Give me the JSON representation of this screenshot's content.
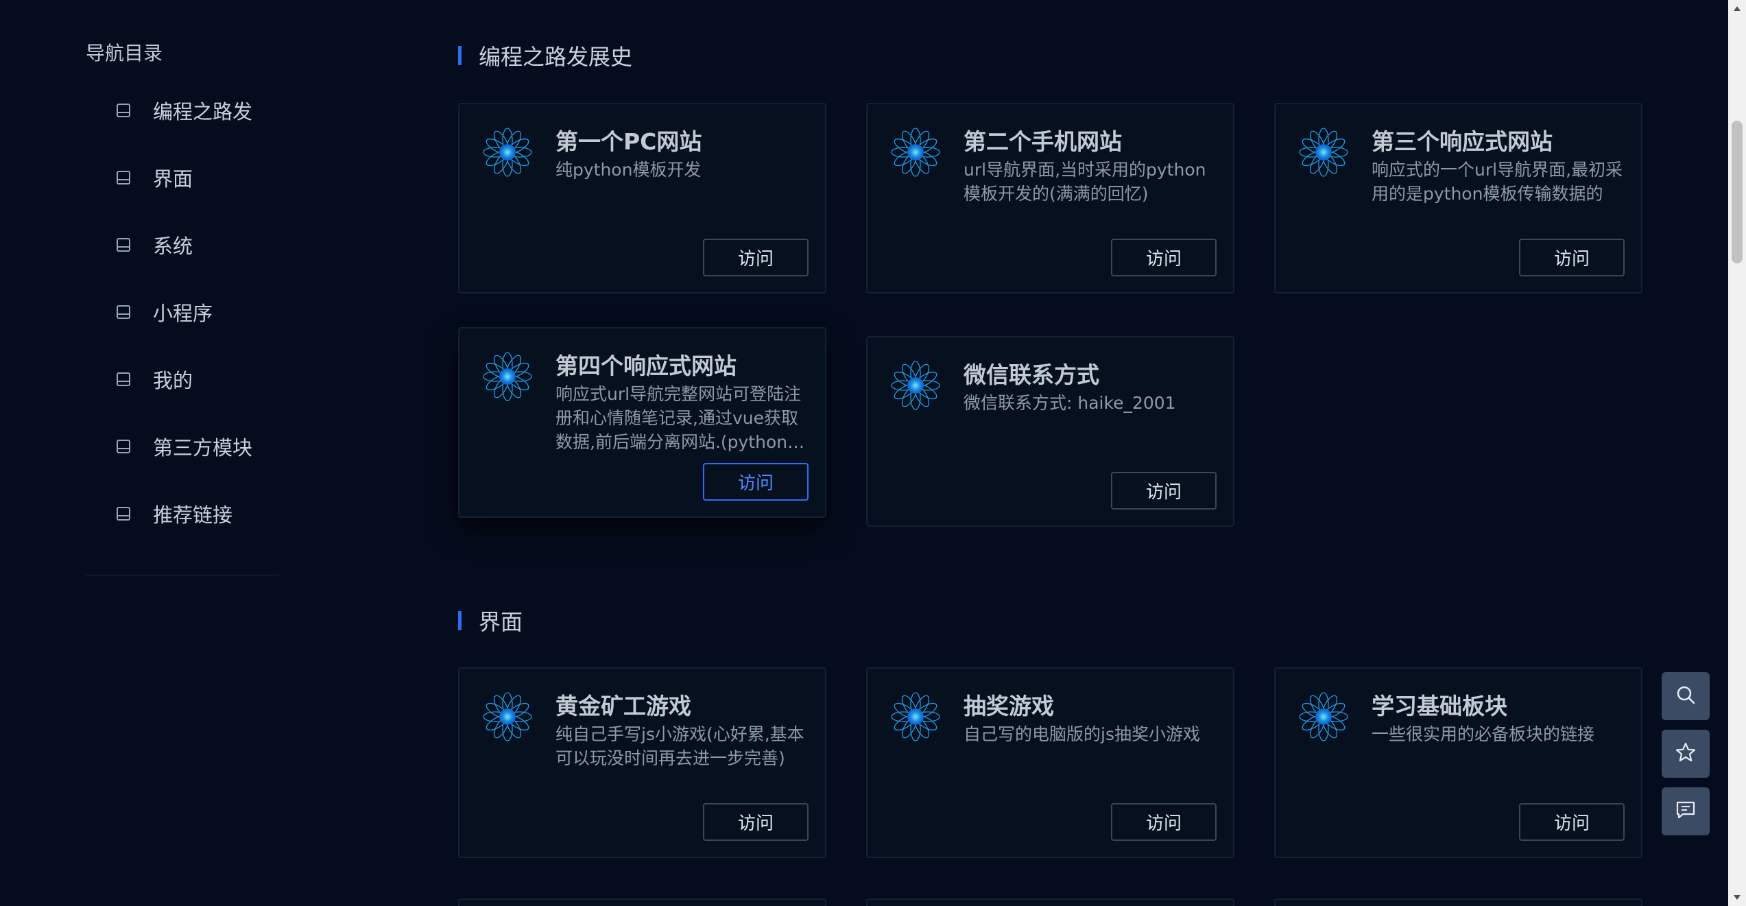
{
  "sidebar": {
    "title": "导航目录",
    "items": [
      {
        "label": "编程之路发"
      },
      {
        "label": "界面"
      },
      {
        "label": "系统"
      },
      {
        "label": "小程序"
      },
      {
        "label": "我的"
      },
      {
        "label": "第三方模块"
      },
      {
        "label": "推荐链接"
      }
    ]
  },
  "sections": [
    {
      "title": "编程之路发展史",
      "cards": [
        {
          "title": "第一个PC网站",
          "desc": "纯python模板开发",
          "button": "访问"
        },
        {
          "title": "第二个手机网站",
          "desc": "url导航界面,当时采用的python模板开发的(满满的回忆)",
          "button": "访问"
        },
        {
          "title": "第三个响应式网站",
          "desc": "响应式的一个url导航界面,最初采用的是python模板传输数据的",
          "button": "访问"
        },
        {
          "title": "第四个响应式网站",
          "desc": "响应式url导航完整网站可登陆注册和心情随笔记录,通过vue获取数据,前后端分离网站.(python写的后",
          "button": "访问"
        },
        {
          "title": "微信联系方式",
          "desc": "微信联系方式: haike_2001",
          "button": "访问"
        }
      ]
    },
    {
      "title": "界面",
      "cards": [
        {
          "title": "黄金矿工游戏",
          "desc": "纯自己手写js小游戏(心好累,基本可以玩没时间再去进一步完善)",
          "button": "访问"
        },
        {
          "title": "抽奖游戏",
          "desc": "自己写的电脑版的js抽奖小游戏",
          "button": "访问"
        },
        {
          "title": "学习基础板块",
          "desc": "一些很实用的必备板块的链接",
          "button": "访问"
        }
      ]
    }
  ],
  "floating_buttons": [
    {
      "icon": "search-icon"
    },
    {
      "icon": "star-icon"
    },
    {
      "icon": "comment-icon"
    }
  ],
  "colors": {
    "background": "#040c1d",
    "card_background": "#06101f",
    "accent": "#2d6ef0",
    "float_button": "#3c4b64"
  }
}
